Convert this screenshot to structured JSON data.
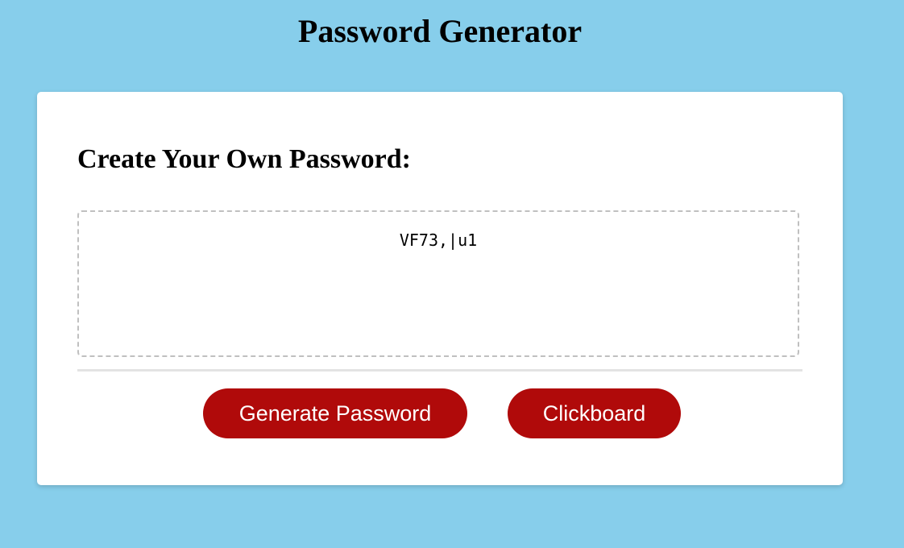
{
  "header": {
    "title": "Password Generator"
  },
  "card": {
    "heading": "Create Your Own Password:",
    "password_value": "VF73,|u1",
    "generate_label": "Generate Password",
    "copy_label": "Clickboard"
  },
  "colors": {
    "background": "#87ceeb",
    "button": "#b00a0a",
    "card": "#ffffff"
  }
}
